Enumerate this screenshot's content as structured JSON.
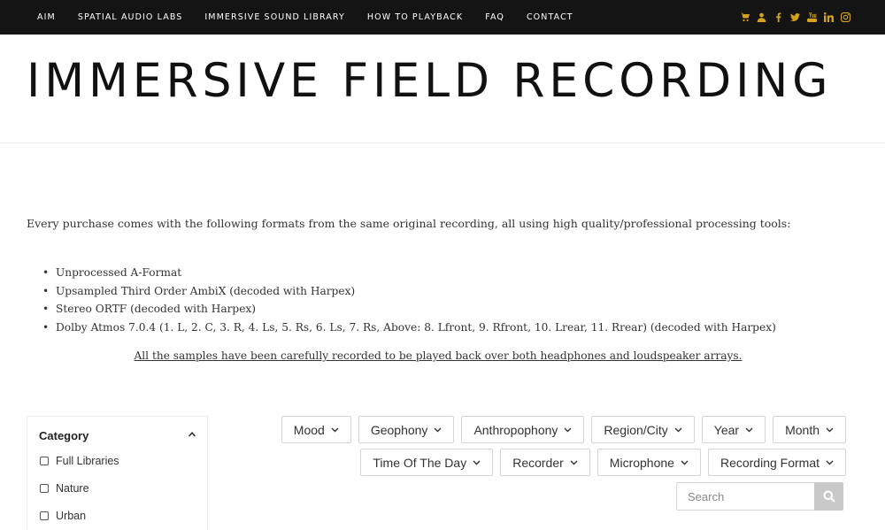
{
  "nav": {
    "links": [
      "AIM",
      "SPATIAL AUDIO LABS",
      "IMMERSIVE SOUND LIBRARY",
      "HOW TO PLAYBACK",
      "FAQ",
      "CONTACT"
    ],
    "icons": [
      "cart-icon",
      "user-icon",
      "facebook-icon",
      "twitter-icon",
      "youtube-icon",
      "linkedin-icon",
      "instagram-icon"
    ],
    "icon_color": "#d4a21c",
    "background": "#141414"
  },
  "header": {
    "title": "IMMERSIVE FIELD RECORDING"
  },
  "content": {
    "intro": "Every purchase comes with the following formats from the same original recording, all using high quality/professional processing tools:",
    "formats": [
      "Unprocessed A-Format",
      "Upsampled Third Order AmbiX (decoded with Harpex)",
      "Stereo ORTF (decoded with Harpex)",
      "Dolby Atmos 7.0.4 (1. L, 2. C, 3. R, 4. Ls, 5. Rs, 6. Ls, 7. Rs, Above: 8. Lfront, 9. Rfront, 10. Lrear, 11. Rrear) (decoded with Harpex)"
    ],
    "samples_note": "All the samples have been carefully recorded to be played back over both headphones and loudspeaker arrays."
  },
  "sidebar": {
    "title": "Category",
    "items": [
      {
        "label": "Full Libraries",
        "checked": false
      },
      {
        "label": "Nature",
        "checked": false
      },
      {
        "label": "Urban",
        "checked": false
      }
    ]
  },
  "filters": {
    "row1": [
      "Mood",
      "Geophony",
      "Anthropophony",
      "Region/City",
      "Year",
      "Month"
    ],
    "row2": [
      "Time Of The Day",
      "Recorder",
      "Microphone",
      "Recording Format"
    ]
  },
  "search": {
    "placeholder": "Search"
  }
}
